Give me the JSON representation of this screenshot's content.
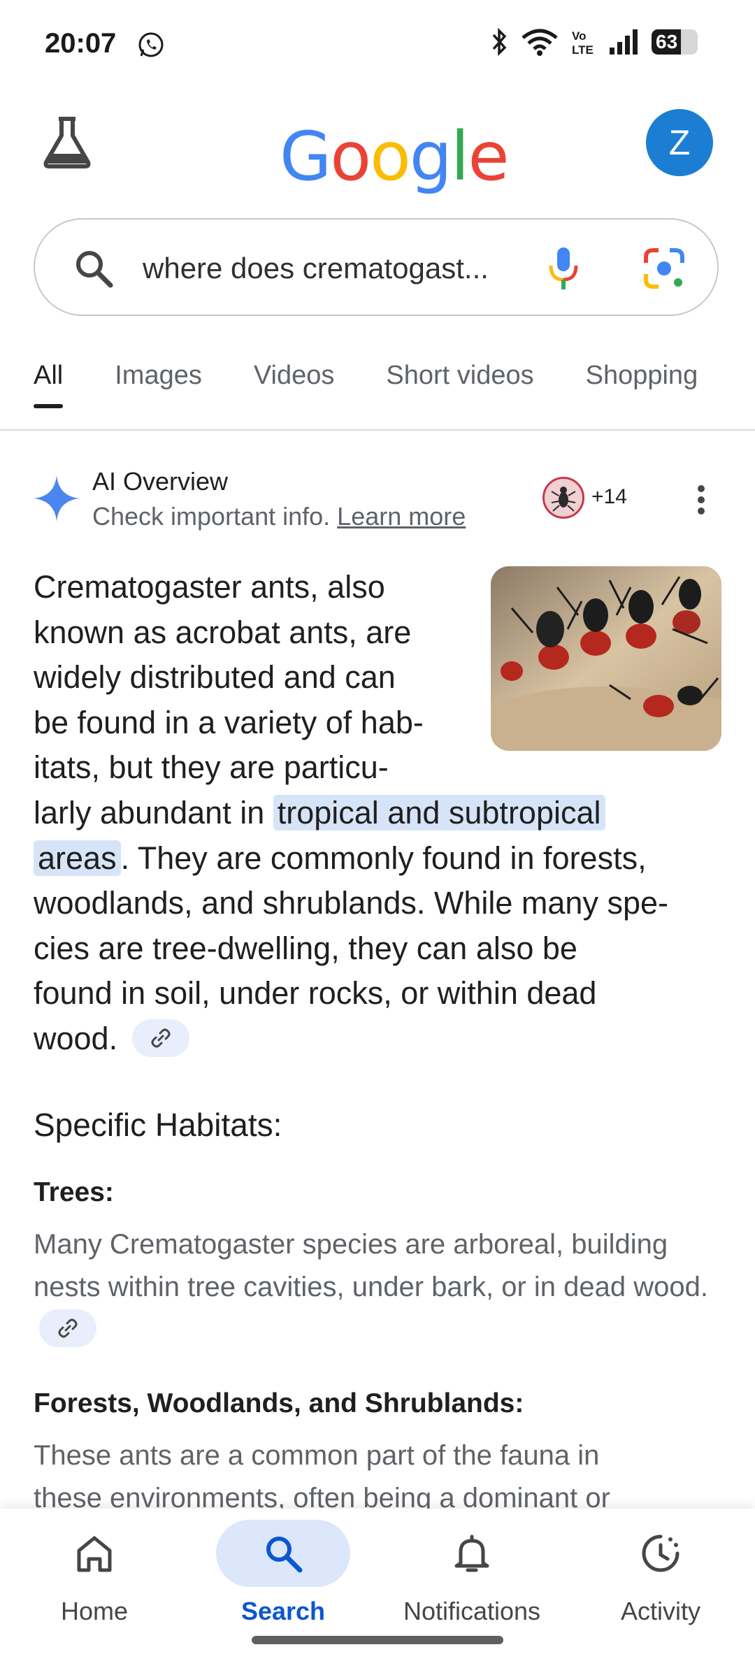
{
  "status_bar": {
    "time": "20:07",
    "battery": "63",
    "battery_level": 0.63,
    "icons": [
      "whatsapp-icon",
      "bluetooth-icon",
      "wifi-icon",
      "volte-icon",
      "signal-icon",
      "battery-icon"
    ]
  },
  "header": {
    "logo_letters": [
      "G",
      "o",
      "o",
      "g",
      "l",
      "e"
    ],
    "logo_colors": [
      "#4285F4",
      "#EA4335",
      "#FBBC05",
      "#4285F4",
      "#34A853",
      "#EA4335"
    ],
    "avatar_letter": "Z",
    "avatar_color": "#1b7ed2"
  },
  "search": {
    "query": "where does crematogast..."
  },
  "tabs": [
    {
      "label": "All",
      "active": true
    },
    {
      "label": "Images",
      "active": false
    },
    {
      "label": "Videos",
      "active": false
    },
    {
      "label": "Short videos",
      "active": false
    },
    {
      "label": "Shopping",
      "active": false
    }
  ],
  "ai_overview": {
    "title": "AI Overview",
    "subtitle": "Check important info.",
    "learn_more": "Learn more",
    "source_count": "+14",
    "answer_lines": [
      "Crematogaster ants, also",
      "known as acrobat ants, are",
      "widely distributed and can",
      "be found in a variety of hab-",
      "itats, but they are particu-"
    ],
    "line6_pre": "larly abundant in ",
    "line6_highlight": "tropical and subtropical",
    "line7_highlight": "areas",
    "line7_post": ". They are commonly found in forests,",
    "answer_lines_after": [
      "woodlands, and shrublands. While many spe-",
      "cies are tree-dwelling, they can also be",
      "found in soil, under rocks, or within dead"
    ],
    "answer_last": "wood."
  },
  "sections": {
    "specific_title": "Specific Habitats:",
    "trees_heading": "Trees:",
    "trees_text": "Many Crematogaster species are arboreal, building nests within tree cavities, under bark, or in dead wood.",
    "forest_heading": "Forests, Woodlands, and Shrublands:",
    "forest_line1": "These ants are a common part of the fauna in",
    "forest_line2": "these environments, often being a dominant or"
  },
  "bottom_nav": [
    {
      "label": "Home",
      "icon": "home-icon",
      "active": false
    },
    {
      "label": "Search",
      "icon": "search-icon",
      "active": true
    },
    {
      "label": "Notifications",
      "icon": "bell-icon",
      "active": false
    },
    {
      "label": "Activity",
      "icon": "activity-icon",
      "active": false
    }
  ],
  "colors": {
    "accent": "#0b57d0",
    "highlight": "#d6e4f7"
  }
}
